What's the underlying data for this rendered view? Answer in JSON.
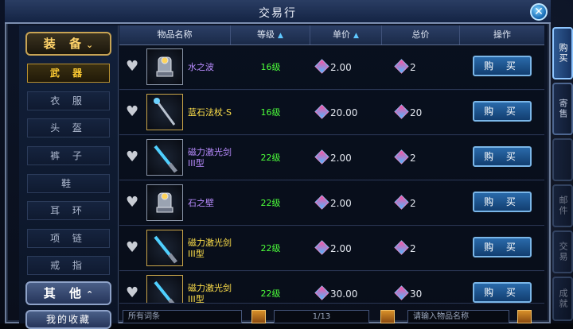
{
  "window": {
    "title": "交易行"
  },
  "sidebar": {
    "group_equip": "装 备",
    "items": [
      {
        "label": "武 器",
        "active": true
      },
      {
        "label": "衣 服"
      },
      {
        "label": "头 盔"
      },
      {
        "label": "裤 子"
      },
      {
        "label": "鞋"
      },
      {
        "label": "耳 环"
      },
      {
        "label": "项 链"
      },
      {
        "label": "戒 指"
      }
    ],
    "group_other": "其 他",
    "favorites": "我的收藏"
  },
  "table": {
    "headers": {
      "name": "物品名称",
      "level": "等级",
      "unit_price": "单价",
      "total_price": "总价",
      "action": "操作"
    },
    "rows": [
      {
        "name": "水之波",
        "level": "16级",
        "unit_price": "2.00",
        "total": "2",
        "buy": "购 买",
        "name_color": "#b98cff",
        "icon": "gauntlet-icon"
      },
      {
        "name": "蓝石法杖-S",
        "level": "16级",
        "unit_price": "20.00",
        "total": "20",
        "buy": "购 买",
        "name_color": "#ffe04a",
        "icon": "staff-icon"
      },
      {
        "name": "磁力激光剑III型",
        "level": "22级",
        "unit_price": "2.00",
        "total": "2",
        "buy": "购 买",
        "name_color": "#b98cff",
        "icon": "laser-sword-icon"
      },
      {
        "name": "石之壁",
        "level": "22级",
        "unit_price": "2.00",
        "total": "2",
        "buy": "购 买",
        "name_color": "#b98cff",
        "icon": "gauntlet-icon"
      },
      {
        "name": "磁力激光剑III型",
        "level": "22级",
        "unit_price": "2.00",
        "total": "2",
        "buy": "购 买",
        "name_color": "#ffe04a",
        "icon": "laser-sword-icon"
      },
      {
        "name": "磁力激光剑III型",
        "level": "22级",
        "unit_price": "30.00",
        "total": "30",
        "buy": "购 买",
        "name_color": "#ffe04a",
        "icon": "laser-sword-icon"
      }
    ]
  },
  "bottom": {
    "filter": "所有词条",
    "page": "1/13",
    "search_placeholder": "请输入物品名称"
  },
  "right_tabs": [
    "购买",
    "寄售",
    "邮件",
    "交易",
    "成就"
  ]
}
